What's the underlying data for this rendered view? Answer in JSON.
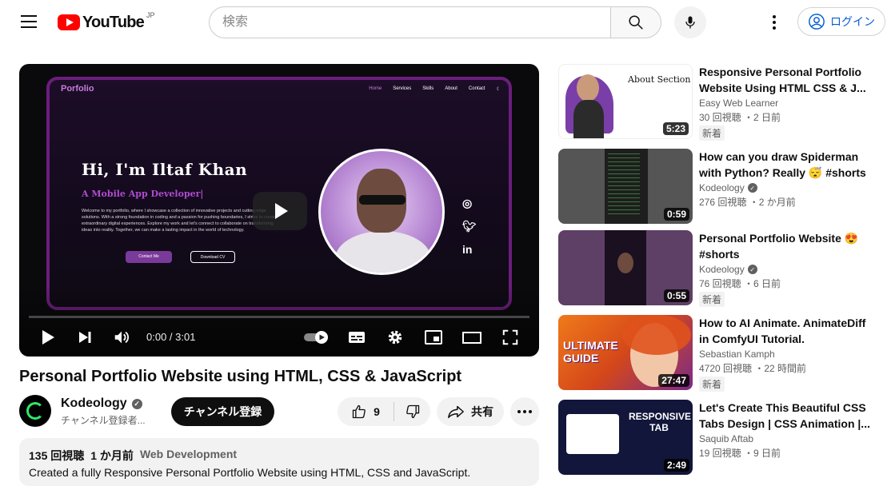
{
  "header": {
    "logo_text": "YouTube",
    "region": "JP",
    "search_placeholder": "検索",
    "login_label": "ログイン",
    "icons": [
      "menu-icon",
      "search-icon",
      "mic-icon",
      "more-vert-icon",
      "account-circle-icon"
    ]
  },
  "player": {
    "time": "0:00 / 3:01",
    "progress_fraction": 0,
    "frame": {
      "logo": "Porfolio",
      "nav_links": [
        "Home",
        "Services",
        "Skills",
        "About",
        "Contact",
        "☾"
      ],
      "title": "Hi, I'm Iltaf Khan",
      "subtitle": "A Mobile App Developer|",
      "paragraph": "Welcome to my portfolio, where I showcase a collection of innovative projects and cutting-edge solutions. With a strong foundation in coding and a passion for pushing boundaries, I strive to create extraordinary digital experiences. Explore my work and let's connect to collaborate on transforming ideas into reality. Together, we can make a lasting impact in the world of technology.",
      "btn_contact": "Contact Me",
      "btn_download": "Download CV"
    }
  },
  "video": {
    "title": "Personal Portfolio Website using HTML, CSS & JavaScript",
    "channel": "Kodeology",
    "subscribers": "チャンネル登録者...",
    "subscribe_label": "チャンネル登録",
    "likes": "9",
    "share_label": "共有",
    "views": "135 回視聴",
    "age": "1 か月前",
    "category": "Web Development",
    "description": "Created a fully Responsive Personal Portfolio Website using HTML, CSS and JavaScript."
  },
  "recommendations": [
    {
      "title": "Responsive Personal Portfolio Website Using HTML CSS & J...",
      "channel": "Easy Web Learner",
      "verified": false,
      "meta": "30 回視聴 ・2 日前",
      "badge": "新着",
      "duration": "5:23",
      "thumb_label": "About Section"
    },
    {
      "title": "How can you draw Spiderman with Python? Really 😴 #shorts",
      "channel": "Kodeology",
      "verified": true,
      "meta": "276 回視聴 ・2 か月前",
      "badge": "",
      "duration": "0:59",
      "thumb_label": ""
    },
    {
      "title": "Personal Portfolio Website 😍 #shorts",
      "channel": "Kodeology",
      "verified": true,
      "meta": "76 回視聴 ・6 日前",
      "badge": "新着",
      "duration": "0:55",
      "thumb_label": ""
    },
    {
      "title": "How to AI Animate. AnimateDiff in ComfyUI Tutorial.",
      "channel": "Sebastian Kamph",
      "verified": false,
      "meta": "4720 回視聴 ・22 時間前",
      "badge": "新着",
      "duration": "27:47",
      "thumb_label": "ULTIMATE GUIDE"
    },
    {
      "title": "Let's Create This Beautiful CSS Tabs Design | CSS Animation |...",
      "channel": "Saquib Aftab",
      "verified": false,
      "meta": "19 回視聴 ・9 日前",
      "badge": "",
      "duration": "2:49",
      "thumb_label": "RESPONSIVE TAB"
    }
  ],
  "colors": {
    "brand": "#ff0000",
    "link": "#065fd4",
    "accent_purple": "#6b1e7c"
  }
}
